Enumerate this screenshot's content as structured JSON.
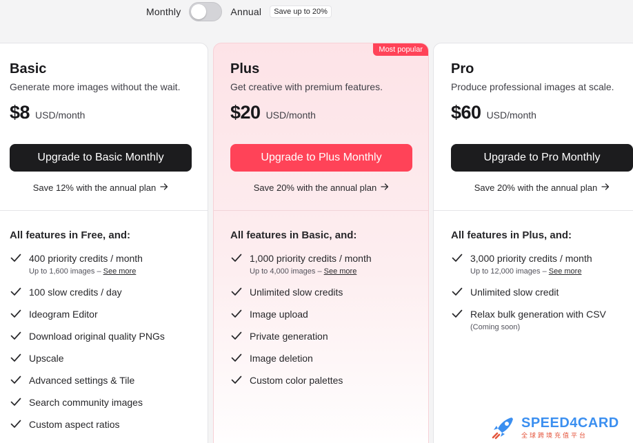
{
  "billing": {
    "monthly_label": "Monthly",
    "annual_label": "Annual",
    "save_badge": "Save up to 20%",
    "toggle_state": "monthly"
  },
  "plans": [
    {
      "name": "Basic",
      "description": "Generate more images without the wait.",
      "price": "$8",
      "unit": "USD/month",
      "cta": "Upgrade to Basic Monthly",
      "annual_link": "Save 12% with the annual plan",
      "features_head": "All features in Free, and:",
      "features": [
        {
          "text": "400 priority credits / month",
          "sub": "Up to 1,600 images – ",
          "link": "See more"
        },
        {
          "text": "100 slow credits / day"
        },
        {
          "text": "Ideogram Editor"
        },
        {
          "text": "Download original quality PNGs"
        },
        {
          "text": "Upscale"
        },
        {
          "text": "Advanced settings & Tile"
        },
        {
          "text": "Search community images"
        },
        {
          "text": "Custom aspect ratios"
        }
      ]
    },
    {
      "name": "Plus",
      "badge": "Most popular",
      "description": "Get creative with premium features.",
      "price": "$20",
      "unit": "USD/month",
      "cta": "Upgrade to Plus Monthly",
      "annual_link": "Save 20% with the annual plan",
      "features_head": "All features in Basic, and:",
      "features": [
        {
          "text": "1,000 priority credits / month",
          "sub": "Up to 4,000 images – ",
          "link": "See more"
        },
        {
          "text": "Unlimited slow credits"
        },
        {
          "text": "Image upload"
        },
        {
          "text": "Private generation"
        },
        {
          "text": "Image deletion"
        },
        {
          "text": "Custom color palettes"
        }
      ]
    },
    {
      "name": "Pro",
      "description": "Produce professional images at scale.",
      "price": "$60",
      "unit": "USD/month",
      "cta": "Upgrade to Pro Monthly",
      "annual_link": "Save 20% with the annual plan",
      "features_head": "All features in Plus, and:",
      "features": [
        {
          "text": "3,000 priority credits / month",
          "sub": "Up to 12,000 images – ",
          "link": "See more"
        },
        {
          "text": "Unlimited slow credit"
        },
        {
          "text": "Relax bulk generation with CSV",
          "sub": "(Coming soon)"
        }
      ]
    }
  ],
  "watermark": {
    "brand": "SPEED4CARD",
    "tagline": "全球跨境充值平台"
  },
  "colors": {
    "accent": "#ff4358",
    "dark_button": "#1c1c1e",
    "plus_bg": "#fde3e7"
  },
  "icons": {
    "check": "check-icon",
    "arrow": "arrow-right-icon",
    "rocket": "rocket-icon"
  }
}
